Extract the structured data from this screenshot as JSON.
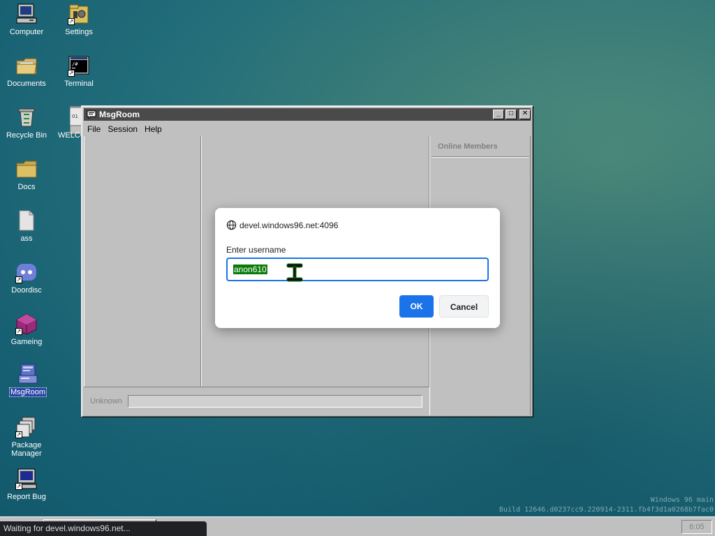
{
  "desktop": {
    "icons": [
      {
        "label": "Computer",
        "icon": "computer-icon",
        "shortcut": false
      },
      {
        "label": "Settings",
        "icon": "settings-icon",
        "shortcut": true
      },
      {
        "label": "Documents",
        "icon": "documents-folder-icon",
        "shortcut": false
      },
      {
        "label": "Terminal",
        "icon": "terminal-icon",
        "shortcut": true
      },
      {
        "label": "Recycle Bin",
        "icon": "recycle-bin-icon",
        "shortcut": false
      },
      {
        "label": "WELCO",
        "icon": "welcome-document-icon",
        "shortcut": false
      },
      {
        "label": "Docs",
        "icon": "folder-icon",
        "shortcut": false
      },
      {
        "label": "ass",
        "icon": "file-icon",
        "shortcut": false
      },
      {
        "label": "Doordisc",
        "icon": "doordisc-icon",
        "shortcut": true
      },
      {
        "label": "Gameing",
        "icon": "gameing-icon",
        "shortcut": true
      },
      {
        "label": "MsgRoom",
        "icon": "msgroom-icon",
        "shortcut": false,
        "selected": true
      },
      {
        "label": "Package Manager",
        "icon": "package-manager-icon",
        "shortcut": true
      },
      {
        "label": "Report Bug",
        "icon": "report-bug-icon",
        "shortcut": true
      }
    ]
  },
  "msgroom": {
    "title": "MsgRoom",
    "menu": [
      "File",
      "Session",
      "Help"
    ],
    "online_members_title": "Online Members",
    "nickname_label": "Unknown"
  },
  "dialog": {
    "origin": "devel.windows96.net:4096",
    "message": "Enter username",
    "input_value": "anon610",
    "ok_label": "OK",
    "cancel_label": "Cancel"
  },
  "browser_status": "Waiting for devel.windows96.net...",
  "watermark": {
    "line1": "Windows 96 main",
    "line2": "Build 12646.d0237cc9.220914-2311.fb4f3d1a0268b7fac0"
  },
  "tray_label": "6:05",
  "colors": {
    "accent": "#1a73e8",
    "selection": "#0a7a0a",
    "titlebar": "#4a4a4a",
    "desktop": "#226d7a"
  }
}
